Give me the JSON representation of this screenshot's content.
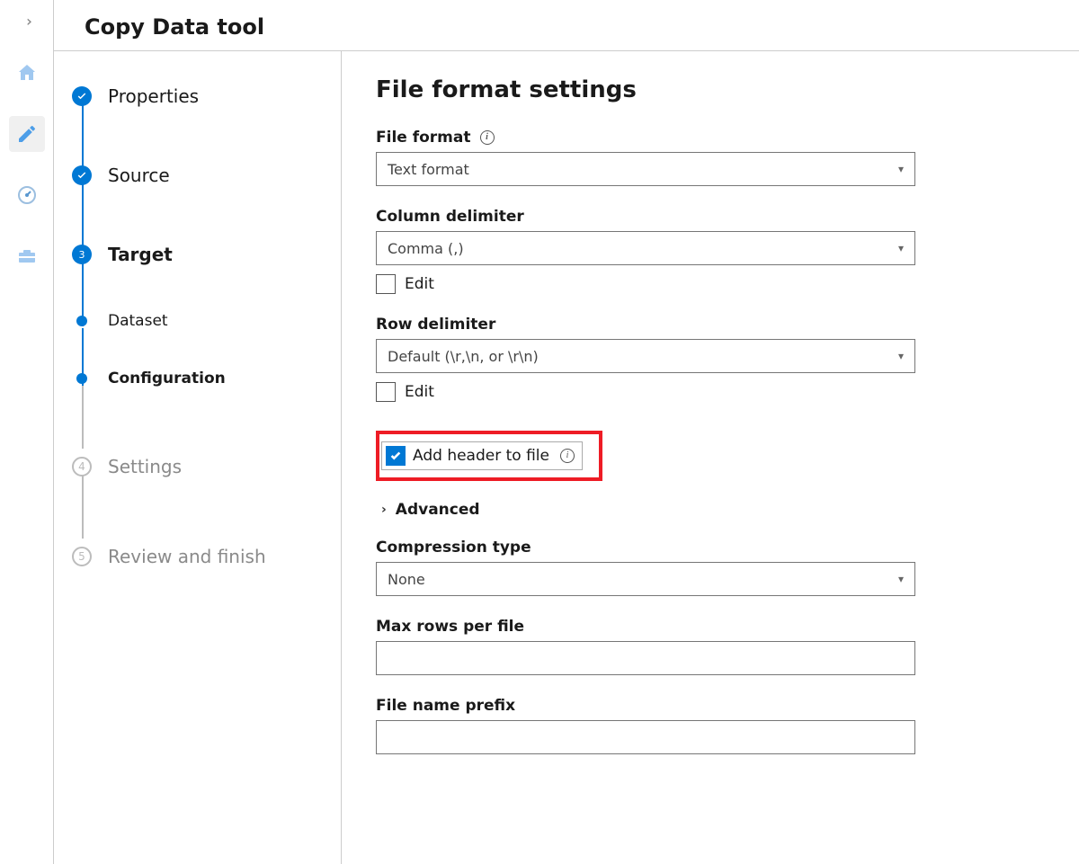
{
  "header": {
    "title": "Copy Data tool"
  },
  "wizard": {
    "steps": [
      {
        "label": "Properties",
        "state": "done"
      },
      {
        "label": "Source",
        "state": "done"
      },
      {
        "label": "Target",
        "state": "current",
        "number": "3",
        "substeps": [
          {
            "label": "Dataset",
            "active": false
          },
          {
            "label": "Configuration",
            "active": true
          }
        ]
      },
      {
        "label": "Settings",
        "state": "pending",
        "number": "4"
      },
      {
        "label": "Review and finish",
        "state": "pending",
        "number": "5"
      }
    ]
  },
  "form": {
    "title": "File format settings",
    "file_format": {
      "label": "File format",
      "value": "Text format"
    },
    "column_delimiter": {
      "label": "Column delimiter",
      "value": "Comma (,)",
      "edit": "Edit"
    },
    "row_delimiter": {
      "label": "Row delimiter",
      "value": "Default (\\r,\\n, or \\r\\n)",
      "edit": "Edit"
    },
    "add_header": {
      "label": "Add header to file",
      "checked": true
    },
    "advanced": {
      "label": "Advanced"
    },
    "compression": {
      "label": "Compression type",
      "value": "None"
    },
    "max_rows": {
      "label": "Max rows per file",
      "value": ""
    },
    "prefix": {
      "label": "File name prefix",
      "value": ""
    }
  }
}
